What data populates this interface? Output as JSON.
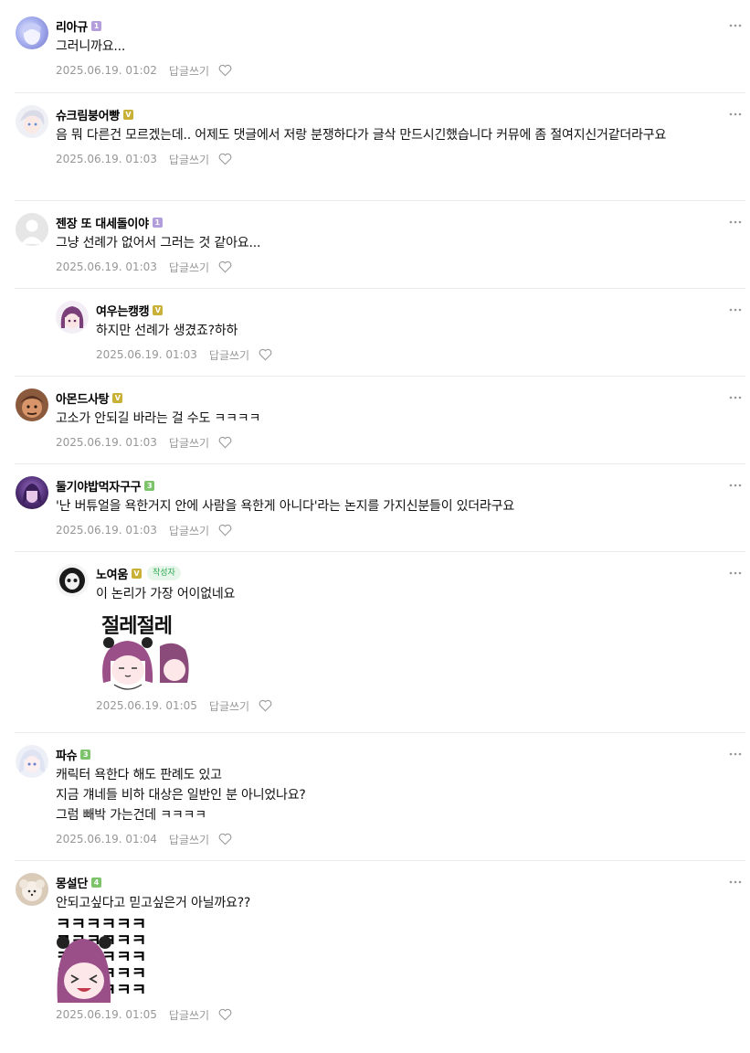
{
  "comments": [
    {
      "nick": "리아규",
      "level": "1",
      "text": "그러니까요...",
      "date": "2025.06.19. 01:02",
      "reply": "답글쓰기"
    },
    {
      "nick": "슈크림붕어빵",
      "level": "V",
      "text": "음 뭐 다른건 모르겠는데.. 어제도 댓글에서 저랑 분쟁하다가 글삭 만드시긴했습니다 커뮤에 좀 절여지신거같더라구요",
      "date": "2025.06.19. 01:03",
      "reply": "답글쓰기"
    },
    {
      "nick": "젠장 또 대세돌이야",
      "level": "1",
      "text": "그냥 선례가 없어서 그러는 것 같아요...",
      "date": "2025.06.19. 01:03",
      "reply": "답글쓰기"
    },
    {
      "nick": "여우는캥캥",
      "level": "V",
      "text": "하지만 선례가 생겼죠?하하",
      "date": "2025.06.19. 01:03",
      "reply": "답글쓰기"
    },
    {
      "nick": "아몬드사탕",
      "level": "V",
      "text": "고소가 안되길 바라는 걸 수도 ㅋㅋㅋㅋ",
      "date": "2025.06.19. 01:03",
      "reply": "답글쓰기"
    },
    {
      "nick": "둘기야밥먹자구구",
      "level": "3",
      "text": "'난 버튜얼을 욕한거지 안에 사람을 욕한게 아니다'라는 논지를 가지신분들이 있더라구요",
      "date": "2025.06.19. 01:03",
      "reply": "답글쓰기"
    },
    {
      "nick": "노여움",
      "level": "V",
      "badge": "작성자",
      "text": "이 논리가 가장 어이없네요",
      "sticker_text": "절레절레",
      "date": "2025.06.19. 01:05",
      "reply": "답글쓰기"
    },
    {
      "nick": "파슈",
      "level": "3",
      "lines": [
        "캐릭터 욕한다 해도 판례도 있고",
        "지금 걔네들 비하 대상은 일반인 분 아니었나요?",
        "그럼 빼박 가는건데 ㅋㅋㅋㅋ"
      ],
      "date": "2025.06.19. 01:04",
      "reply": "답글쓰기"
    },
    {
      "nick": "몽설단",
      "level": "4",
      "text": "안되고싶다고 믿고싶은거 아닐까요??",
      "sticker_text": "ㅋㅋㅋㅋㅋㅋㅋ",
      "date": "2025.06.19. 01:05",
      "reply": "답글쓰기"
    }
  ],
  "icons": {
    "more": "more-dots-icon",
    "like": "heart-icon"
  },
  "colors": {
    "meta": "#979797",
    "divider": "#ebebeb",
    "author_badge": "#2ea84f"
  }
}
